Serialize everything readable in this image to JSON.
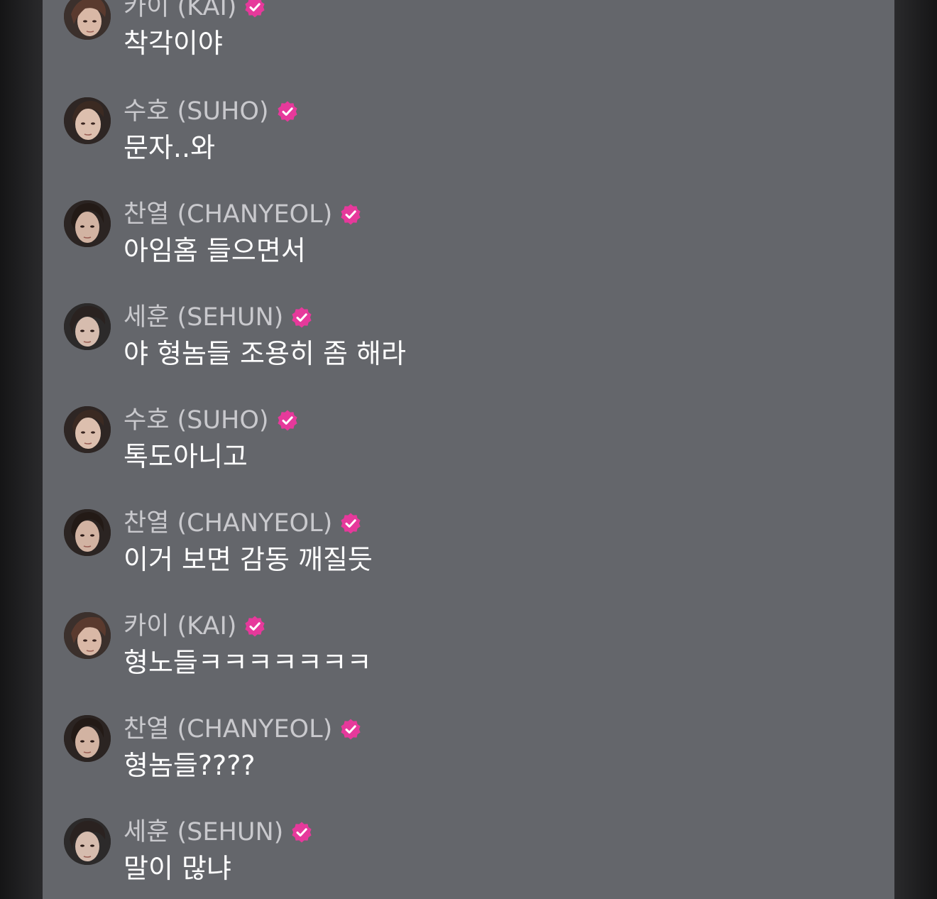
{
  "colors": {
    "panel_bg": "#64666b",
    "name_color": "#c9c9cd",
    "text_color": "#ffffff",
    "badge_color": "#e6399b"
  },
  "messages": [
    {
      "sender": "카이 (KAI)",
      "text": "착각이야",
      "avatar": "kai-avatar"
    },
    {
      "sender": "수호 (SUHO)",
      "text": "문자..와",
      "avatar": "suho-avatar"
    },
    {
      "sender": "찬열 (CHANYEOL)",
      "text": "아임홈 들으면서",
      "avatar": "chanyeol-avatar"
    },
    {
      "sender": "세훈 (SEHUN)",
      "text": "야 형놈들 조용히 좀 해라",
      "avatar": "sehun-avatar"
    },
    {
      "sender": "수호 (SUHO)",
      "text": "톡도아니고",
      "avatar": "suho-avatar"
    },
    {
      "sender": "찬열 (CHANYEOL)",
      "text": "이거 보면 감동 깨질듯",
      "avatar": "chanyeol-avatar"
    },
    {
      "sender": "카이 (KAI)",
      "text": "형노들ㅋㅋㅋㅋㅋㅋㅋ",
      "avatar": "kai-avatar"
    },
    {
      "sender": "찬열 (CHANYEOL)",
      "text": "형놈들????",
      "avatar": "chanyeol-avatar"
    },
    {
      "sender": "세훈 (SEHUN)",
      "text": "말이 많냐",
      "avatar": "sehun-avatar"
    }
  ]
}
